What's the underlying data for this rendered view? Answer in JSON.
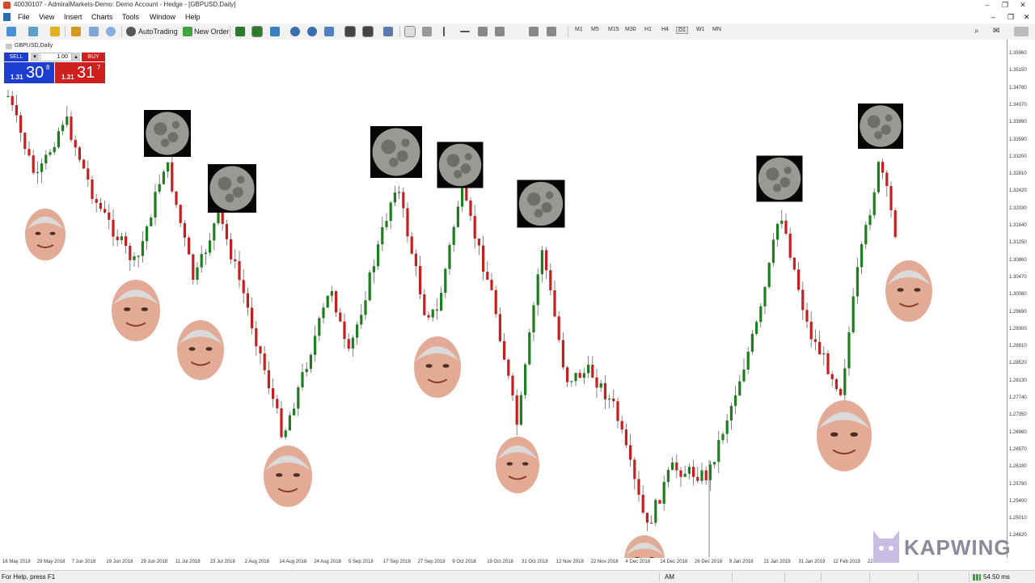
{
  "window": {
    "title": "40030107 - AdmiralMarkets-Demo: Demo Account - Hedge - [GBPUSD,Daily]",
    "controls": [
      "–",
      "❐",
      "✕"
    ]
  },
  "menu": [
    "File",
    "View",
    "Insert",
    "Charts",
    "Tools",
    "Window",
    "Help"
  ],
  "toolbar": {
    "autotrading_label": "AutoTrading",
    "new_order_label": "New Order",
    "timeframes": [
      "M1",
      "M5",
      "M15",
      "M30",
      "H1",
      "H4",
      "D1",
      "W1",
      "MN"
    ],
    "active_timeframe": "D1"
  },
  "chart": {
    "symbol_label": "GBPUSD,Daily"
  },
  "trade_panel": {
    "sell_label": "SELL",
    "buy_label": "BUY",
    "lot_value": "1.00",
    "sell_prefix": "1.31",
    "sell_big": "30",
    "sell_sup": "8",
    "buy_prefix": "1.31",
    "buy_big": "31",
    "buy_sup": "7"
  },
  "price_axis": [
    "1.35960",
    "1.35150",
    "1.34760",
    "1.34370",
    "1.33990",
    "1.33590",
    "1.33200",
    "1.32810",
    "1.32420",
    "1.32030",
    "1.31640",
    "1.31250",
    "1.30860",
    "1.30470",
    "1.30080",
    "1.29690",
    "1.29300",
    "1.28910",
    "1.28520",
    "1.28130",
    "1.27740",
    "1.27350",
    "1.26960",
    "1.26570",
    "1.26180",
    "1.25790",
    "1.25400",
    "1.25010",
    "1.24620"
  ],
  "date_axis": [
    "16 May 2018",
    "29 May 2018",
    "7 Jun 2018",
    "19 Jun 2018",
    "29 Jun 2018",
    "11 Jul 2018",
    "23 Jul 2018",
    "2 Aug 2018",
    "14 Aug 2018",
    "24 Aug 2018",
    "5 Sep 2018",
    "17 Sep 2018",
    "27 Sep 2018",
    "9 Oct 2018",
    "19 Oct 2018",
    "31 Oct 2018",
    "12 Nov 2018",
    "22 Nov 2018",
    "4 Dec 2018",
    "14 Dec 2018",
    "26 Dec 2018",
    "9 Jan 2019",
    "21 Jan 2019",
    "31 Jan 2019",
    "12 Feb 2019",
    "22 Feb 2019"
  ],
  "status": {
    "help": "For Help, press F1",
    "clock": "AM",
    "ping": "54.50 ms"
  },
  "watermark": "KAPWING",
  "colors": {
    "bull": "#1e7d1e",
    "bear": "#c81e1e",
    "sell": "#1c3dcf",
    "buy": "#cf2020"
  }
}
